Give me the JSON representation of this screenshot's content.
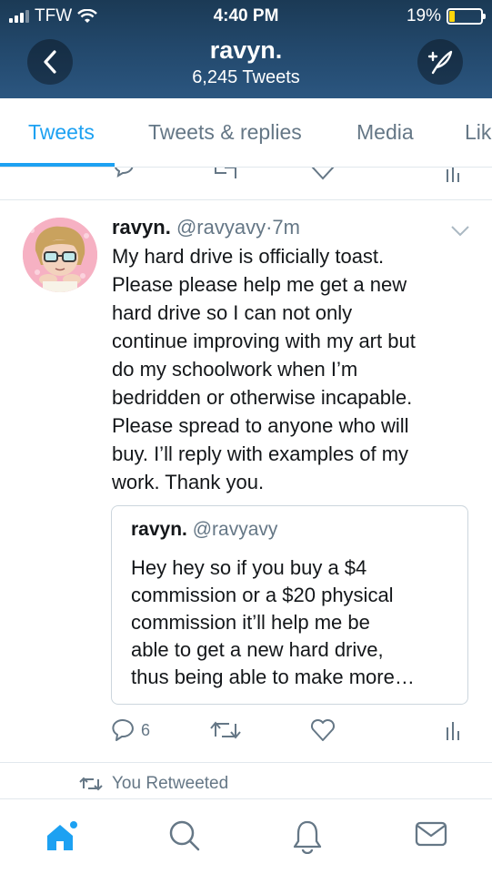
{
  "status_bar": {
    "carrier": "TFW",
    "time": "4:40 PM",
    "battery": "19%",
    "battery_level": 0.19
  },
  "header": {
    "name": "ravyn.",
    "tweet_count": "6,245 Tweets"
  },
  "tabs": [
    {
      "label": "Tweets",
      "active": true
    },
    {
      "label": "Tweets & replies",
      "active": false
    },
    {
      "label": "Media",
      "active": false
    },
    {
      "label": "Lik",
      "active": false
    }
  ],
  "tweet": {
    "name": "ravyn.",
    "handle": "@ravyavy",
    "separator": "·",
    "time": "7m",
    "lines": [
      "My hard drive is officially toast.",
      "Please please help me get a new",
      "hard drive so I can not only",
      "continue improving with my art but",
      "do my schoolwork when I’m",
      "bedridden or otherwise incapable.",
      "Please spread to anyone who will",
      "buy. I’ll reply with examples of my",
      "work. Thank you."
    ],
    "quote": {
      "name": "ravyn.",
      "handle": "@ravyavy",
      "lines": [
        "Hey hey so if you buy a $4",
        "commission or a $20 physical",
        "commission it’ll help me be",
        "able to get a new hard drive,",
        "thus being able to make more…"
      ]
    },
    "actions": {
      "reply_count": "6"
    }
  },
  "retweet_context": "You Retweeted",
  "colors": {
    "accent": "#1da1f2",
    "muted": "#657786",
    "text": "#14171a",
    "header_bg": "#22476a"
  },
  "icons": {
    "back": "chevron-left-icon",
    "compose": "compose-tweet-icon",
    "reply": "reply-icon",
    "retweet": "retweet-icon",
    "like": "heart-icon",
    "analytics": "analytics-icon",
    "home": "home-icon",
    "search": "search-icon",
    "notifications": "bell-icon",
    "messages": "mail-icon"
  }
}
